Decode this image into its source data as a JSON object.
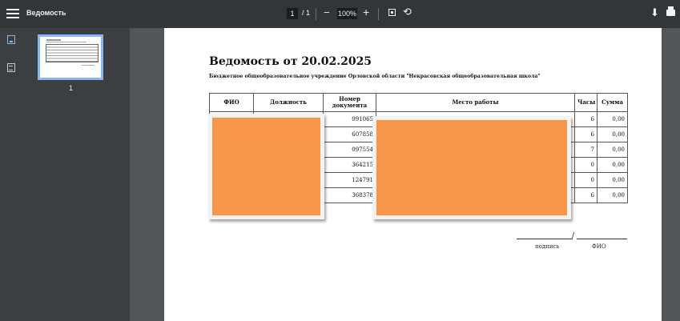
{
  "toolbar": {
    "title": "Ведомость",
    "current_page": "1",
    "total_pages": "/ 1",
    "zoom_out": "−",
    "zoom_level": "100%",
    "zoom_in": "+",
    "rotate": "⟲",
    "download": "⬇"
  },
  "sidebar": {
    "thumbnail_label": "1"
  },
  "document": {
    "title": "Ведомость от 20.02.2025",
    "subtitle": "Бюджетное общеобразовательное учреждение Орловской области \"Некрасовская общеобразовательная школа\"",
    "columns": [
      "ФИО",
      "Должность",
      "Номер документа",
      "Место работы",
      "Часы",
      "Сумма"
    ],
    "rows": [
      {
        "doc": "091065",
        "hours": "6",
        "sum": "0,00"
      },
      {
        "doc": "607858",
        "hours": "6",
        "sum": "0,00"
      },
      {
        "doc": "097554",
        "hours": "7",
        "sum": "0,00"
      },
      {
        "doc": "364215",
        "hours": "0",
        "sum": "0,00"
      },
      {
        "doc": "124791",
        "hours": "0",
        "sum": "0,00"
      },
      {
        "doc": "368378",
        "hours": "6",
        "sum": "0,00"
      }
    ],
    "signature_label": "подпись",
    "signature_slash": "/",
    "name_label": "ФИО"
  },
  "colors": {
    "toolbar": "#323639",
    "sidebar": "#3b3f42",
    "viewer_bg": "#525659",
    "redaction": "#f5964b",
    "accent": "#8ab4f8"
  }
}
